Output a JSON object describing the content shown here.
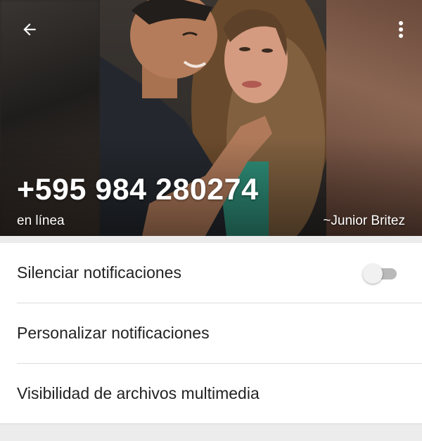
{
  "header": {
    "phone_number": "+595 984 280274",
    "status": "en línea",
    "push_name": "~Junior Britez",
    "back_icon": "arrow-left-icon",
    "menu_icon": "more-vert-icon"
  },
  "settings": {
    "items": [
      {
        "label": "Silenciar notificaciones",
        "toggle": false
      },
      {
        "label": "Personalizar notificaciones"
      },
      {
        "label": "Visibilidad de archivos multimedia"
      }
    ]
  },
  "colors": {
    "text_primary": "#222222",
    "toggle_track_off": "#b9b9b9",
    "toggle_thumb_off": "#f1f1f1"
  }
}
